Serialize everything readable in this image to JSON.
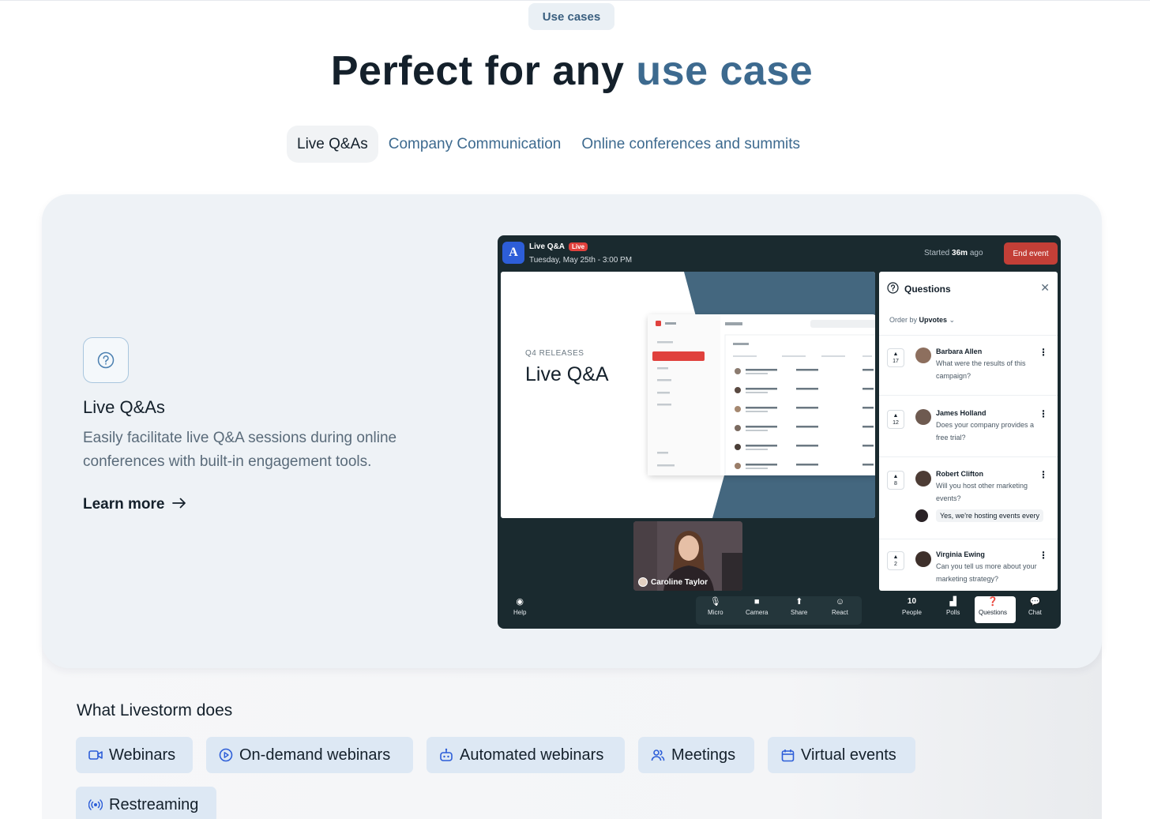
{
  "eyebrow": "Use cases",
  "headline": {
    "main": "Perfect for any ",
    "accent": "use case"
  },
  "tabs": [
    {
      "label": "Live Q&As",
      "active": true
    },
    {
      "label": "Company Communication",
      "active": false
    },
    {
      "label": "Online conferences and summits",
      "active": false
    }
  ],
  "feature": {
    "icon": "question-circle-icon",
    "title": "Live Q&As",
    "description": "Easily facilitate live Q&A sessions during online conferences with built-in engagement tools.",
    "link_label": "Learn more",
    "link_icon": "arrow-right-icon"
  },
  "app": {
    "logo_letter": "A",
    "title": "Live Q&A",
    "live_badge": "Live",
    "date": "Tuesday, May 25th - 3:00 PM",
    "started_prefix": "Started ",
    "started_value": "36m",
    "started_suffix": " ago",
    "end_button": "End event",
    "slide": {
      "subtitle": "Q4 RELEASES",
      "title": "Live Q&A"
    },
    "speaker": "Caroline Taylor",
    "questions_panel": {
      "title": "Questions",
      "order_prefix": "Order by ",
      "order_value": "Upvotes",
      "items": [
        {
          "votes": "17",
          "name": "Barbara Allen",
          "text": "What were the results of this campaign?"
        },
        {
          "votes": "12",
          "name": "James Holland",
          "text": "Does your company provides a free trial?"
        },
        {
          "votes": "8",
          "name": "Robert Clifton",
          "text": "Will you host other marketing events?",
          "answer": "Yes, we're hosting events every"
        },
        {
          "votes": "2",
          "name": "Virginia Ewing",
          "text": "Can you tell us more about your marketing strategy?"
        }
      ]
    },
    "bottom_bar": {
      "help": "Help",
      "micro": "Micro",
      "camera": "Camera",
      "share": "Share",
      "react": "React",
      "people_count": "10",
      "people": "People",
      "polls": "Polls",
      "questions": "Questions",
      "chat": "Chat"
    }
  },
  "does_section": {
    "title": "What Livestorm does",
    "chips": [
      {
        "label": "Webinars",
        "icon": "video-camera-icon"
      },
      {
        "label": "On-demand webinars",
        "icon": "play-circle-icon"
      },
      {
        "label": "Automated webinars",
        "icon": "robot-icon"
      },
      {
        "label": "Meetings",
        "icon": "users-icon"
      },
      {
        "label": "Virtual events",
        "icon": "calendar-icon"
      },
      {
        "label": "Restreaming",
        "icon": "broadcast-icon"
      }
    ]
  },
  "colors": {
    "accent": "#3d6a8f",
    "brand_blue": "#2d5ed8",
    "end_red": "#c33f37",
    "chip_bg": "#dde8f4",
    "card_bg": "#eef2f6"
  }
}
